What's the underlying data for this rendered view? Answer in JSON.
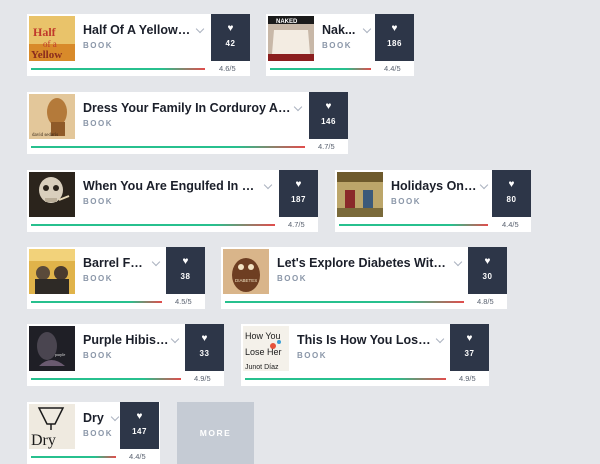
{
  "books": [
    {
      "title": "Half Of A Yellow S...",
      "type": "BOOK",
      "likes": "42",
      "rating": "4.6/5",
      "rating_value": 4.6,
      "cover_color": "#d89a2c",
      "cover_icon": "half-of-a-yellow-sun-cover-icon"
    },
    {
      "title": "Nak...",
      "type": "BOOK",
      "likes": "186",
      "rating": "4.4/5",
      "rating_value": 4.4,
      "cover_color": "#b9a898",
      "cover_icon": "naked-cover-icon"
    },
    {
      "title": "Dress Your Family In Corduroy And D...",
      "type": "BOOK",
      "likes": "146",
      "rating": "4.7/5",
      "rating_value": 4.7,
      "cover_color": "#b07a3c",
      "cover_icon": "dress-your-family-cover-icon"
    },
    {
      "title": "When You Are Engulfed In Flam...",
      "type": "BOOK",
      "likes": "187",
      "rating": "4.7/5",
      "rating_value": 4.7,
      "cover_color": "#3b2f22",
      "cover_icon": "engulfed-in-flames-cover-icon"
    },
    {
      "title": "Holidays On I...",
      "type": "BOOK",
      "likes": "80",
      "rating": "4.4/5",
      "rating_value": 4.4,
      "cover_color": "#9c8a4a",
      "cover_icon": "holidays-on-ice-cover-icon"
    },
    {
      "title": "Barrel Fev...",
      "type": "BOOK",
      "likes": "38",
      "rating": "4.5/5",
      "rating_value": 4.5,
      "cover_color": "#d9a544",
      "cover_icon": "barrel-fever-cover-icon"
    },
    {
      "title": "Let's Explore Diabetes With Ow...",
      "type": "BOOK",
      "likes": "30",
      "rating": "4.8/5",
      "rating_value": 4.8,
      "cover_color": "#7a4a2e",
      "cover_icon": "diabetes-owls-cover-icon"
    },
    {
      "title": "Purple Hibisc...",
      "type": "BOOK",
      "likes": "33",
      "rating": "4.9/5",
      "rating_value": 4.9,
      "cover_color": "#2a2a32",
      "cover_icon": "purple-hibiscus-cover-icon"
    },
    {
      "title": "This Is How You Lose H...",
      "type": "BOOK",
      "likes": "37",
      "rating": "4.9/5",
      "rating_value": 4.9,
      "cover_color": "#f2efe8",
      "cover_icon": "lose-her-cover-icon"
    },
    {
      "title": "Dry",
      "type": "BOOK",
      "likes": "147",
      "rating": "4.4/5",
      "rating_value": 4.4,
      "cover_color": "#e8e2d8",
      "cover_icon": "dry-cover-icon"
    }
  ],
  "more_label": "MORE",
  "colors": {
    "background": "#e4e6ea",
    "like_button": "#2d3648",
    "bar_green": "#27c08e",
    "bar_red": "#e24c4c"
  }
}
